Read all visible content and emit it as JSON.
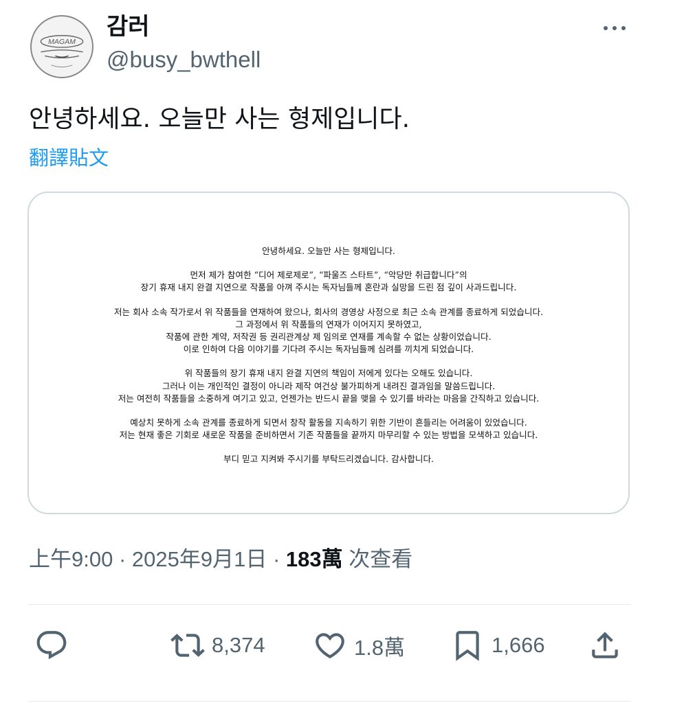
{
  "user": {
    "display_name": "감러",
    "handle": "@busy_bwthell",
    "avatar_text": "MAGAM"
  },
  "tweet": {
    "text": "안녕하세요. 오늘만 사는 형제입니다.",
    "translate_label": "翻譯貼文"
  },
  "letter": {
    "paragraphs": [
      [
        "안녕하세요. 오늘만 사는 형제입니다."
      ],
      [
        "먼저 제가 참여한 “디어 제로제로”, “파울즈 스타트”, “악당만 취급합니다”의",
        "장기 휴재 내지 완결 지연으로 작품을 아껴 주시는 독자님들께 혼란과 실망을 드린 점 깊이 사과드립니다."
      ],
      [
        "저는 회사 소속 작가로서 위 작품들을 연재하여 왔으나, 회사의 경영상 사정으로 최근 소속 관계를 종료하게 되었습니다.",
        "그 과정에서 위 작품들의 연재가 이어지지 못하였고,",
        "작품에 관한 계약, 저작권 등 권리관계상 제 임의로 연재를 계속할 수 없는 상황이었습니다.",
        "이로 인하여 다음 이야기를 기다려 주시는 독자님들께 심려를 끼치게 되었습니다."
      ],
      [
        "위 작품들의 장기 휴재 내지 완결 지연의 책임이 저에게 있다는 오해도 있습니다.",
        "그러나 이는 개인적인 결정이 아니라 제작 여건상 불가피하게 내려진 결과임을 말씀드립니다.",
        "저는 여전히 작품들을 소중하게 여기고 있고, 언젠가는 반드시 끝을 맺을 수 있기를 바라는 마음을 간직하고 있습니다."
      ],
      [
        "예상치 못하게 소속 관계를 종료하게 되면서 창작 활동을 지속하기 위한 기반이 흔들리는 어려움이 있었습니다.",
        "저는 현재 좋은 기회로 새로운 작품을 준비하면서 기존 작품들을 끝까지 마무리할 수 있는 방법을 모색하고 있습니다."
      ],
      [
        "부디 믿고 지켜봐 주시기를 부탁드리겠습니다. 감사합니다."
      ]
    ]
  },
  "meta": {
    "time": "上午9:00",
    "separator": " · ",
    "date": "2025年9月1日",
    "views_count": "183萬",
    "views_label": " 次查看"
  },
  "actions": {
    "reply_count": "",
    "retweet_count": "8,374",
    "like_count": "1.8萬",
    "bookmark_count": "1,666"
  },
  "icons": {
    "reply": "reply-icon",
    "retweet": "retweet-icon",
    "like": "heart-icon",
    "bookmark": "bookmark-icon",
    "share": "share-icon",
    "more": "more-icon"
  },
  "colors": {
    "link": "#1d9bf0",
    "secondary_text": "#536471",
    "border": "#cfd9de"
  }
}
